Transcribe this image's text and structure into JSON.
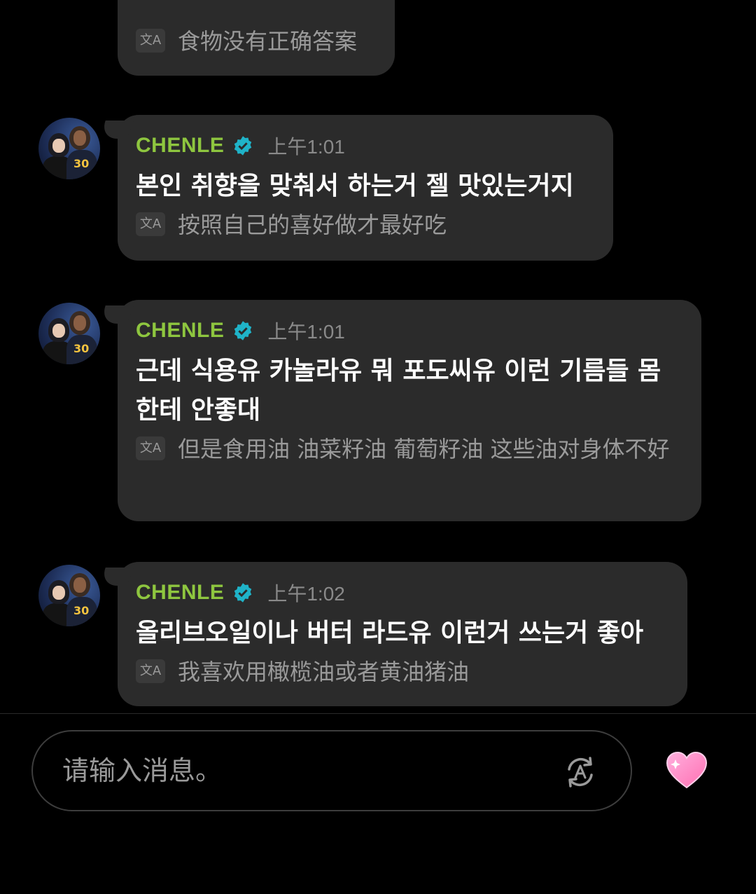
{
  "colors": {
    "background": "#000000",
    "bubble": "#2b2b2b",
    "name": "#8ec63f",
    "verified": "#1fb3c8",
    "timestamp": "#8a8a8a",
    "translation": "#9a9a9a",
    "heart": "#ff7fbf"
  },
  "icons": {
    "translate": "translate-icon",
    "verified": "verified-badge-icon",
    "auto_translate": "auto-translate-icon",
    "heart": "heart-icon"
  },
  "top_message": {
    "translation": "食物没有正确答案"
  },
  "messages": [
    {
      "name": "CHENLE",
      "time": "上午1:01",
      "text": "본인 취향을 맞춰서 하는거 젤 맛있는거지",
      "translation": "按照自己的喜好做才最好吃"
    },
    {
      "name": "CHENLE",
      "time": "上午1:01",
      "text": "근데 식용유 카놀라유 뭐 포도씨유 이런 기름들 몸\n한테 안좋대",
      "translation": "但是食用油 油菜籽油 葡萄籽油 这些油对身体不好"
    },
    {
      "name": "CHENLE",
      "time": "上午1:02",
      "text": "올리브오일이나 버터 라드유 이런거 쓰는거 좋아",
      "translation": "我喜欢用橄榄油或者黄油猪油"
    }
  ],
  "composer": {
    "placeholder": "请输入消息。"
  }
}
